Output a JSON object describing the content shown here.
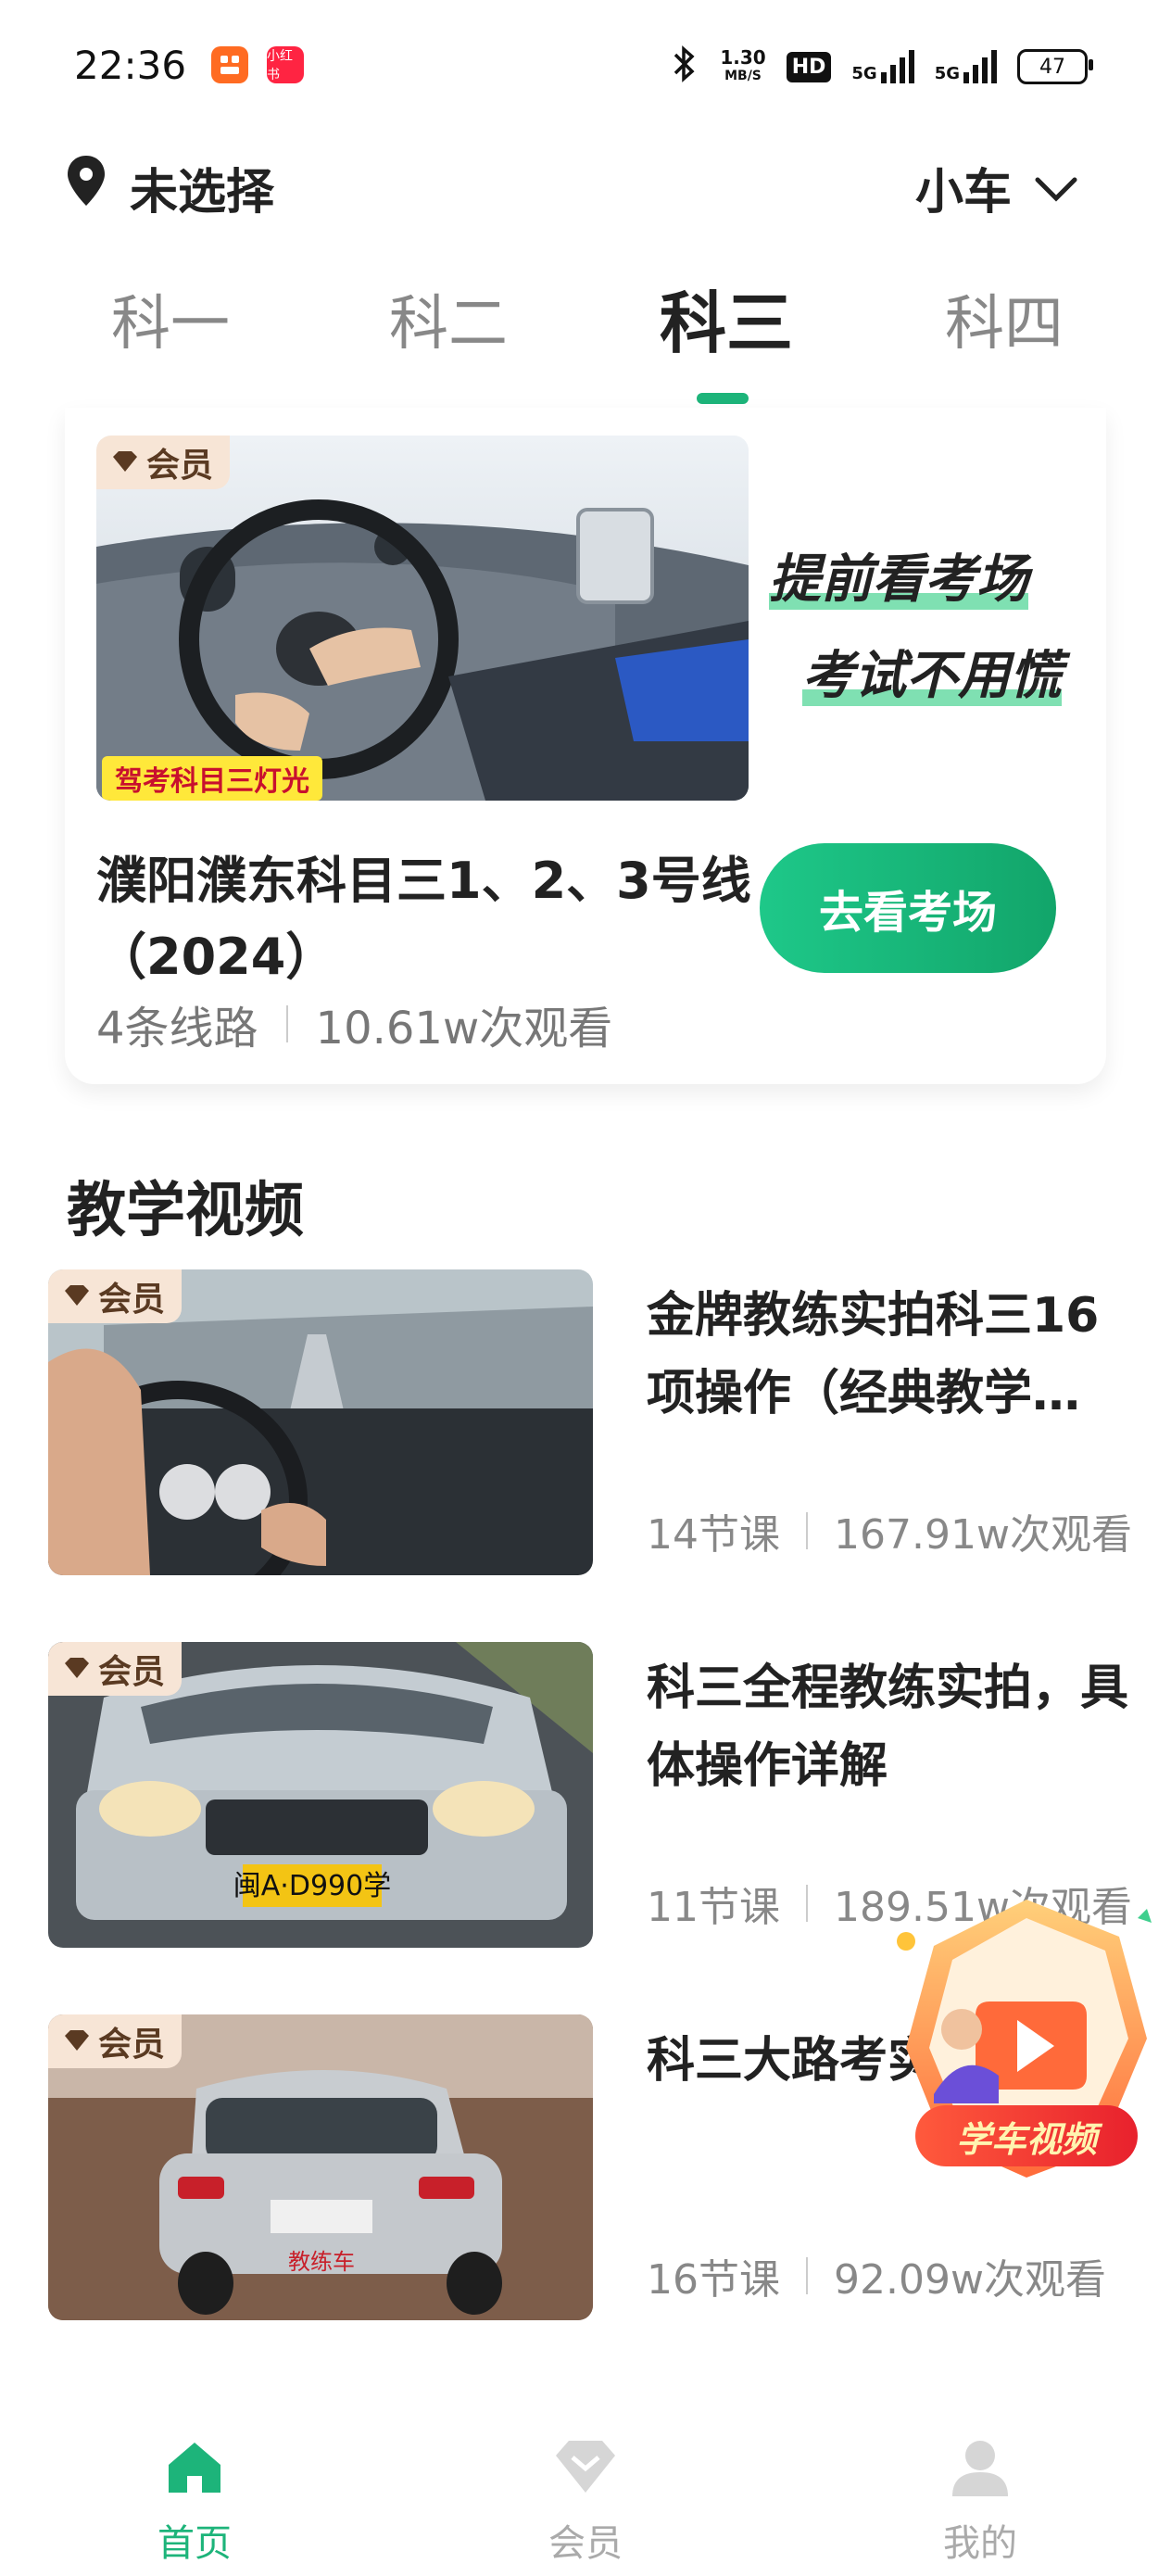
{
  "status_bar": {
    "time": "22:36",
    "app_badge_2": "小红书",
    "speed_value": "1.30",
    "speed_unit": "MB/S",
    "hd": "HD",
    "net1": "5G",
    "net2": "5G",
    "battery": "47"
  },
  "header": {
    "location": "未选择",
    "car_type": "小车"
  },
  "tabs": [
    {
      "label": "科一"
    },
    {
      "label": "科二"
    },
    {
      "label": "科三"
    },
    {
      "label": "科四"
    }
  ],
  "active_tab": "科三",
  "featured": {
    "badge": "会员",
    "image_caption": "驾考科目三灯光",
    "slogan_line1": "提前看考场",
    "slogan_line2": "考试不用慌",
    "title": "濮阳濮东科目三1、2、3号线（2024）",
    "routes": "4条线路",
    "views": "10.61w次观看",
    "button": "去看考场"
  },
  "section_title": "教学视频",
  "videos": [
    {
      "badge": "会员",
      "title": "金牌教练实拍科三16项操作（经典教学…",
      "lessons": "14节课",
      "views": "167.91w次观看"
    },
    {
      "badge": "会员",
      "title": "科三全程教练实拍，具体操作详解",
      "lessons": "11节课",
      "views": "189.51w次观看"
    },
    {
      "badge": "会员",
      "title": "科三大路考实拍教学",
      "lessons": "16节课",
      "views": "92.09w次观看"
    }
  ],
  "plate_text": "闽A·D990学",
  "coach_car_text": "教练车",
  "float_widget": {
    "label": "学车视频"
  },
  "bottom_nav": [
    {
      "label": "首页",
      "icon": "home-icon"
    },
    {
      "label": "会员",
      "icon": "diamond-icon"
    },
    {
      "label": "我的",
      "icon": "person-icon"
    }
  ],
  "colors": {
    "accent": "#1db47a",
    "member_badge": "#f7e5d6"
  }
}
